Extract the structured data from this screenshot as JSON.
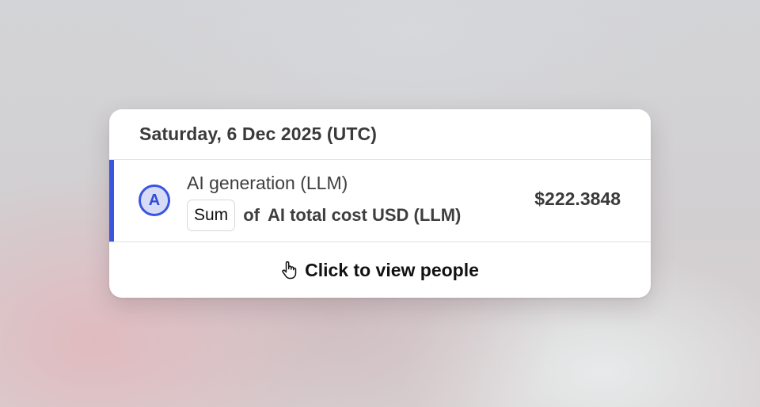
{
  "tooltip": {
    "date": "Saturday, 6 Dec 2025 (UTC)",
    "series": {
      "badge_letter": "A",
      "name": "AI generation (LLM)",
      "math_type": "Sum",
      "math_of": "of",
      "property": "AI total cost USD (LLM)",
      "value": "$222.3848",
      "color": "#3a55e0"
    },
    "footer": {
      "icon": "hand-pointer-icon",
      "label": "Click to view people"
    }
  }
}
